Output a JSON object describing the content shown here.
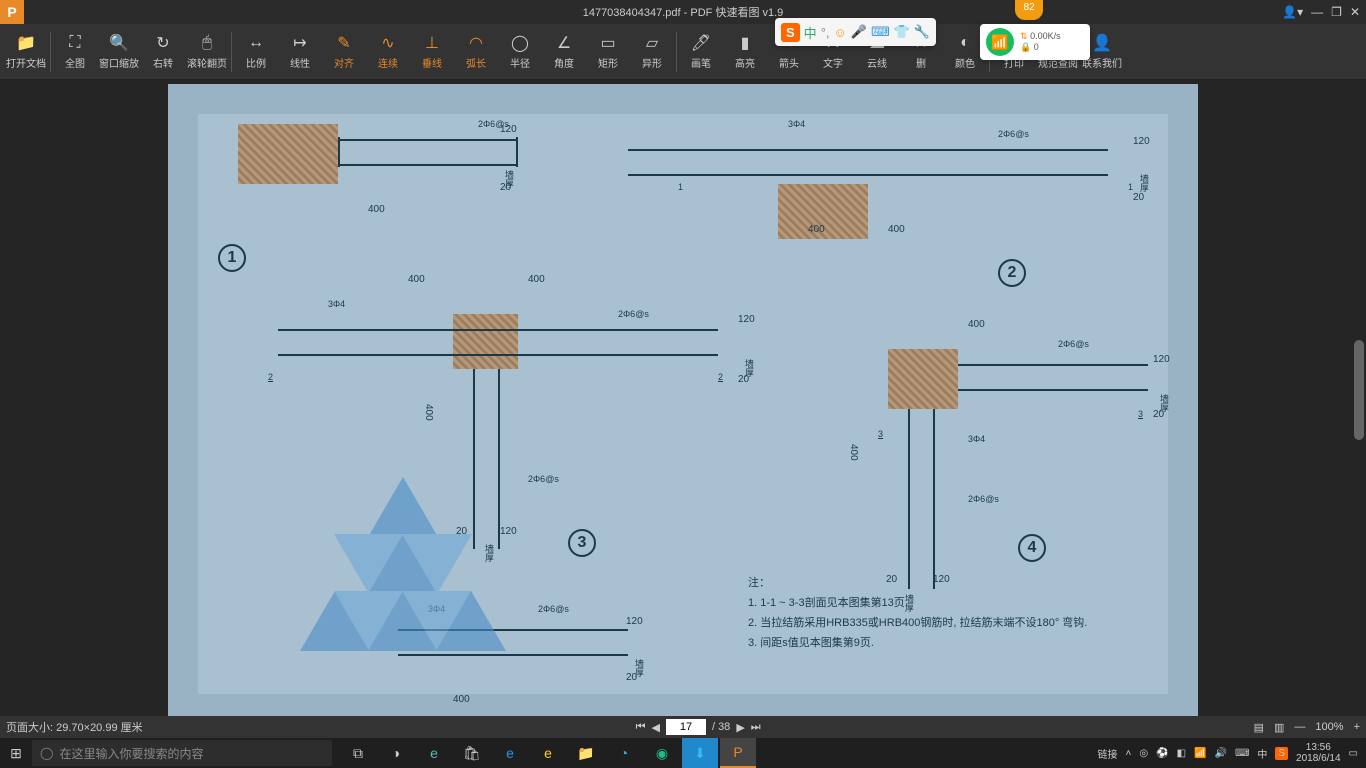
{
  "titlebar": {
    "filename": "1477038404347.pdf",
    "app": "PDF 快速看图 v1.9"
  },
  "toolbar": {
    "items": [
      {
        "label": "打开文档",
        "icon": "📁"
      },
      {
        "label": "全图",
        "icon": "⛶"
      },
      {
        "label": "窗口缩放",
        "icon": "🔍"
      },
      {
        "label": "右转",
        "icon": "↻"
      },
      {
        "label": "滚轮翻页",
        "icon": "🖱"
      },
      {
        "label": "比例",
        "icon": "↔"
      },
      {
        "label": "线性",
        "icon": "↦"
      },
      {
        "label": "对齐",
        "icon": "✎"
      },
      {
        "label": "连续",
        "icon": "∿"
      },
      {
        "label": "垂线",
        "icon": "⊥"
      },
      {
        "label": "弧长",
        "icon": "◠"
      },
      {
        "label": "半径",
        "icon": "◯"
      },
      {
        "label": "角度",
        "icon": "∠"
      },
      {
        "label": "矩形",
        "icon": "▭"
      },
      {
        "label": "异形",
        "icon": "▱"
      },
      {
        "label": "画笔",
        "icon": "🖊"
      },
      {
        "label": "高亮",
        "icon": "▮"
      },
      {
        "label": "箭头",
        "icon": "→"
      },
      {
        "label": "文字",
        "icon": "A"
      },
      {
        "label": "云线",
        "icon": "☁"
      },
      {
        "label": "删",
        "icon": "✕"
      },
      {
        "label": "颜色",
        "icon": "◐"
      },
      {
        "label": "打印",
        "icon": "🖨"
      },
      {
        "label": "规范查阅",
        "icon": "📖"
      },
      {
        "label": "联系我们",
        "icon": "👤"
      }
    ],
    "seps": [
      0,
      4,
      14,
      21
    ]
  },
  "drawing": {
    "details": [
      "1",
      "2",
      "3",
      "4"
    ],
    "dims": {
      "d400": "400",
      "d20": "20",
      "d120": "120"
    },
    "labels": {
      "rebar1": "3Φ4",
      "rebar2": "2Φ6@s",
      "wall": "墙厚"
    },
    "notes": {
      "title": "注：",
      "n1": "1. 1-1 ~ 3-3剖面见本图集第13页.",
      "n2": "2. 当拉结筋采用HRB335或HRB400钢筋时, 拉结筋末端不设180° 弯钩.",
      "n3": "3. 间距s值见本图集第9页."
    }
  },
  "status": {
    "pagesize": "页面大小:  29.70×20.99 厘米",
    "page_current": "17",
    "page_total": "/ 38",
    "zoom": "100%"
  },
  "taskbar": {
    "search_placeholder": "在这里输入你要搜索的内容",
    "tray": {
      "conn": "链接",
      "time": "13:56",
      "date": "2018/6/14",
      "ime": "中"
    }
  },
  "ime": {
    "s": "S",
    "zhong": "中"
  },
  "net": {
    "speed": "0.00K/s",
    "count": "0"
  },
  "badge": "82"
}
